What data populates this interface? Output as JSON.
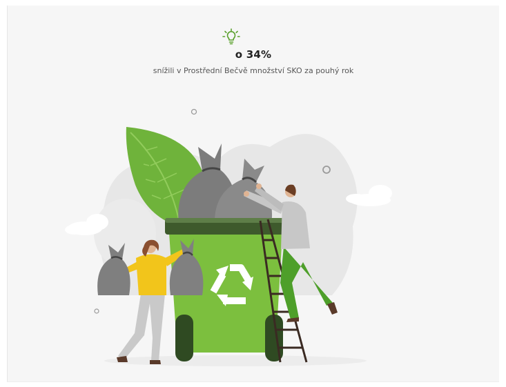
{
  "stat": {
    "headline": "o 34%",
    "description": "snížili v Prostřední Bečvě množství SKO za pouhý rok"
  },
  "colors": {
    "accent_green": "#5aa02c",
    "bin_green": "#7cbf3e",
    "bag_gray": "#808080",
    "person_yellow": "#f2c51b",
    "background": "#f6f6f6"
  },
  "icons": {
    "header_icon": "lightbulb-icon",
    "bin_symbol": "recycle-icon"
  }
}
